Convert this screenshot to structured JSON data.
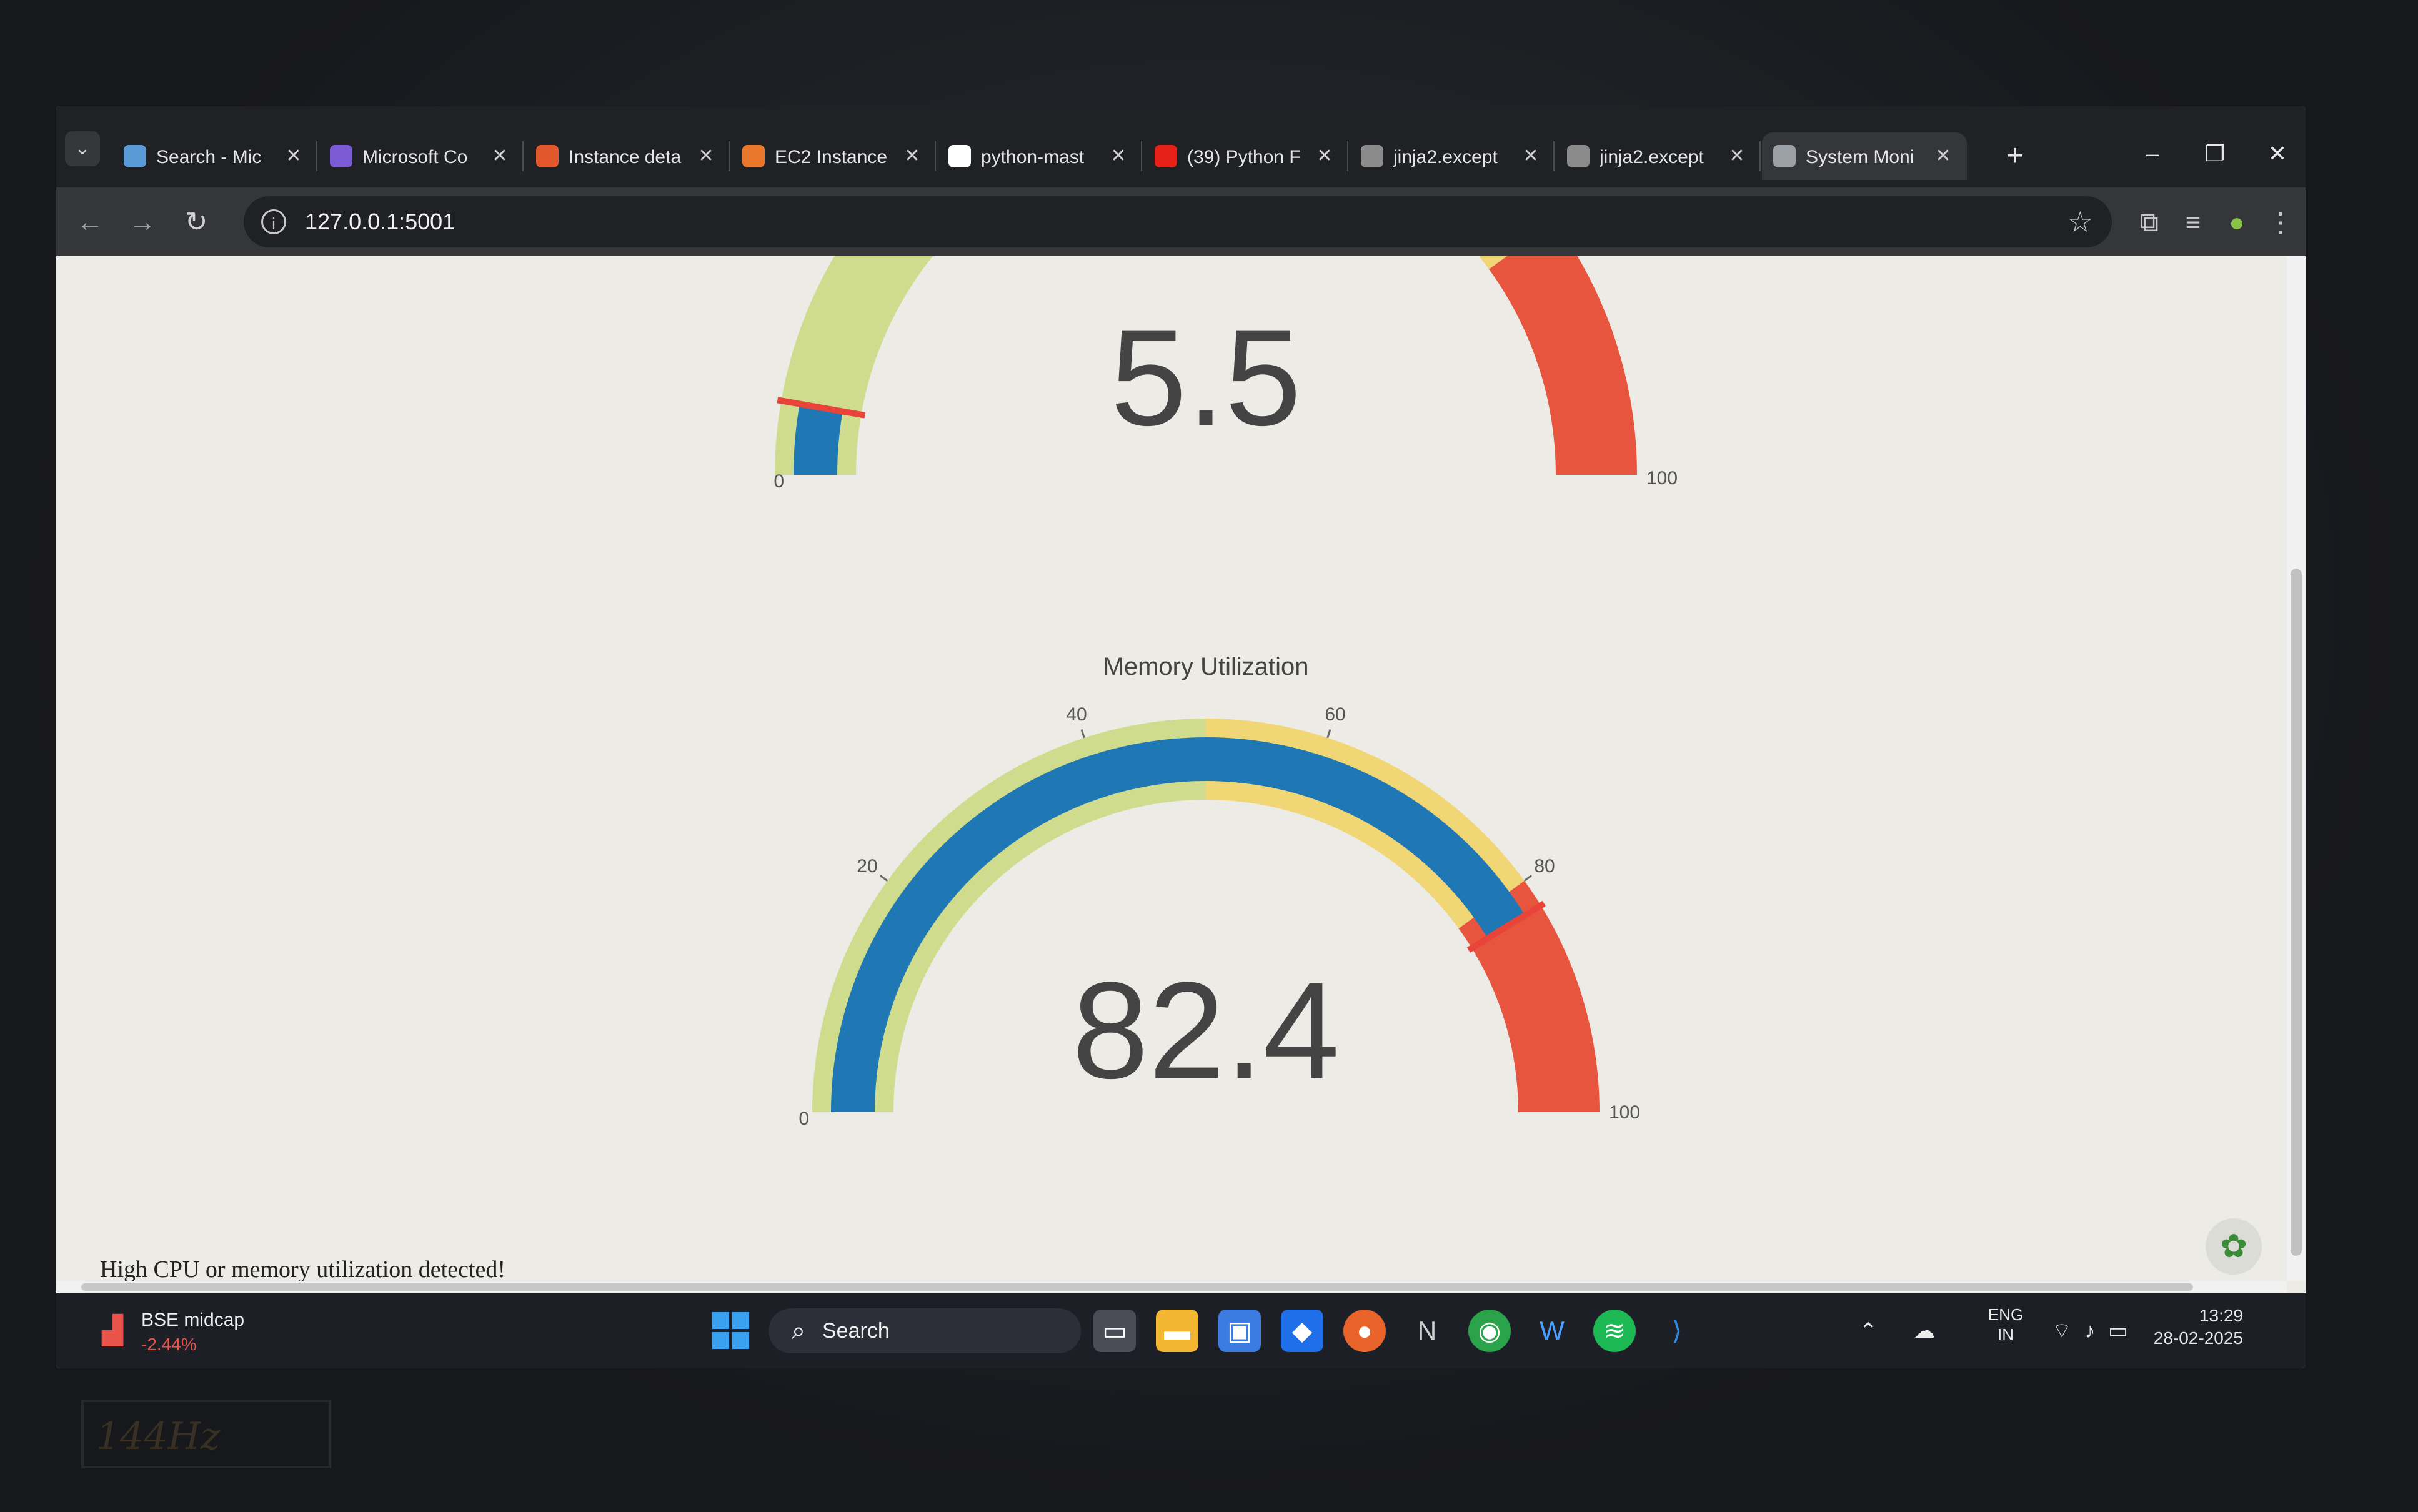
{
  "browser": {
    "tabs": [
      {
        "label": "Search - Mic",
        "icon": "search-icon",
        "color": "#5b9bd5"
      },
      {
        "label": "Microsoft Co",
        "icon": "copilot-icon",
        "color": "#7b5bd5"
      },
      {
        "label": "Instance deta",
        "icon": "ubuntu-icon",
        "color": "#e2572b"
      },
      {
        "label": "EC2 Instance",
        "icon": "aws-icon",
        "color": "#e8772b"
      },
      {
        "label": "python-mast",
        "icon": "github-icon",
        "color": "#ffffff"
      },
      {
        "label": "(39) Python F",
        "icon": "youtube-icon",
        "color": "#e62117"
      },
      {
        "label": "jinja2.except",
        "icon": "page-icon",
        "color": "#8a8a8a"
      },
      {
        "label": "jinja2.except",
        "icon": "page-icon",
        "color": "#8a8a8a"
      },
      {
        "label": "System Moni",
        "icon": "globe-icon",
        "color": "#9aa0a6",
        "active": true
      }
    ],
    "url": "127.0.0.1:5001"
  },
  "dashboard": {
    "cpu_gauge": {
      "value": "5.5",
      "value_num": 5.5,
      "min_label": "0",
      "max_label": "100",
      "threshold": 5.5
    },
    "memory_gauge": {
      "title": "Memory Utilization",
      "value": "82.4",
      "value_num": 82.4,
      "min_label": "0",
      "max_label": "100",
      "ticks": [
        "20",
        "40",
        "60",
        "80"
      ],
      "threshold": 82.4
    },
    "steps": [
      {
        "range": [
          0,
          50
        ],
        "color": "#cfdc8e"
      },
      {
        "range": [
          50,
          80
        ],
        "color": "#f0d675"
      },
      {
        "range": [
          80,
          100
        ],
        "color": "#e8553f"
      }
    ],
    "bar_color": "#1f77b4",
    "threshold_color": "#e8443a",
    "alert": "High CPU or memory utilization detected!"
  },
  "taskbar": {
    "widget_name": "BSE midcap",
    "widget_value": "-2.44%",
    "search_label": "Search",
    "lang_top": "ENG",
    "lang_bottom": "IN",
    "time": "13:29",
    "date": "28-02-2025"
  }
}
